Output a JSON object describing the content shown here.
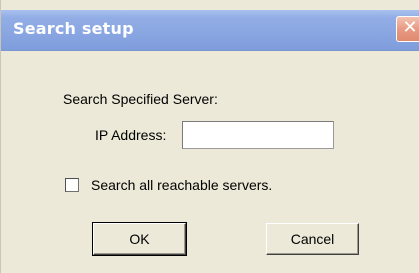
{
  "window": {
    "title": "Search setup",
    "close_glyph": "✕"
  },
  "form": {
    "server_heading": "Search Specified Server:",
    "ip_label": "IP Address:",
    "ip_value": "",
    "search_all_label": "Search all reachable servers.",
    "search_all_checked": false
  },
  "buttons": {
    "ok_label": "OK",
    "cancel_label": "Cancel"
  },
  "colors": {
    "titlebar": "#8aa7e2",
    "dialog_bg": "#ece9d8",
    "close_button": "#e99a82"
  },
  "icons": {
    "close": "close-icon"
  }
}
